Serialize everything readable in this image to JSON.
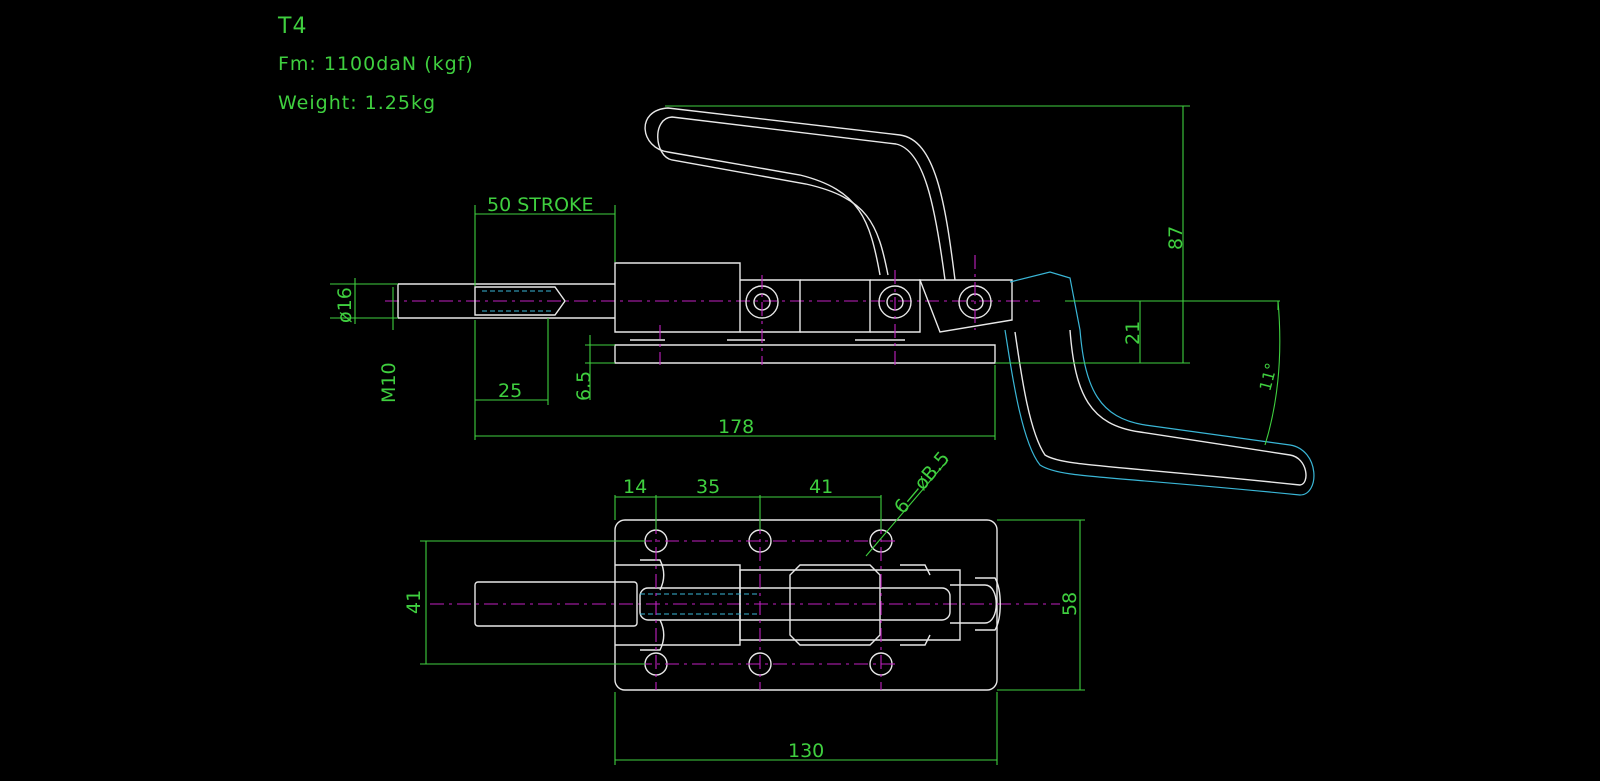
{
  "header": {
    "model": "T4",
    "force": "Fm: 1100daN (kgf)",
    "weight": "Weight: 1.25kg"
  },
  "dimensions": {
    "stroke": "50 STROKE",
    "rod_dia": "ø16",
    "thread": "M10",
    "thread_len": "25",
    "base_thick": "6.5",
    "total_len": "178",
    "center_h": "21",
    "height": "87",
    "angle": "11°",
    "hole_off_1": "14",
    "hole_off_2": "35",
    "hole_off_3": "41",
    "holes": "6—øB.5",
    "hole_span": "41",
    "base_w": "58",
    "base_len": "130"
  },
  "colors": {
    "background": "#000000",
    "dimension": "#3fcf3f",
    "outline": "#e8e8e8",
    "centerline": "#c020c0",
    "hidden": "#3ab6d6"
  }
}
